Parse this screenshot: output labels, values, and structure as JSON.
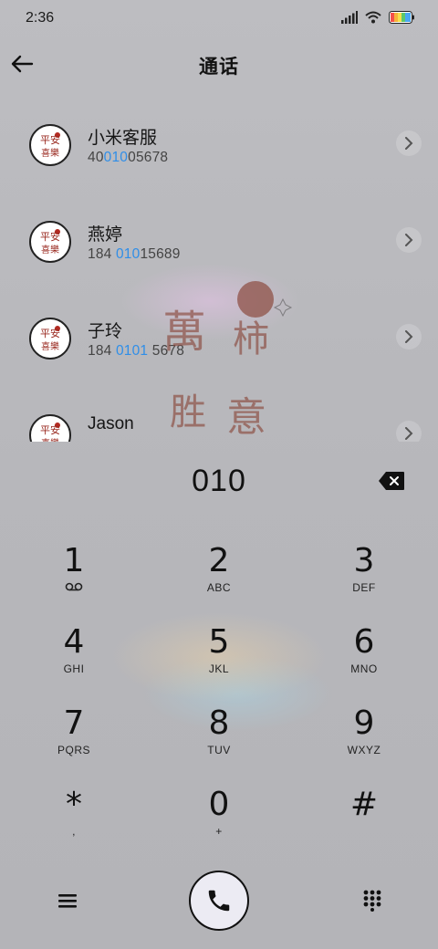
{
  "status_bar": {
    "time": "2:36"
  },
  "header": {
    "title": "通话"
  },
  "contacts": [
    {
      "name": "小米客服",
      "number_pre": "40",
      "number_hl": "010",
      "number_post": "05678"
    },
    {
      "name": "燕婷",
      "number_pre": "184 ",
      "number_hl": "010",
      "number_post": "15689"
    },
    {
      "name": "子玲",
      "number_pre": "184 ",
      "number_hl": "0101",
      "number_post": " 5678"
    },
    {
      "name": "Jason",
      "number_pre": "",
      "number_hl": "",
      "number_post": ""
    }
  ],
  "avatar_text": {
    "line1": "平安",
    "line2": "喜樂"
  },
  "watermark": {
    "chars": [
      "萬",
      "柿",
      "胜",
      "意"
    ]
  },
  "dialer": {
    "entry": "010"
  },
  "keys": [
    {
      "digit": "1",
      "letters": ""
    },
    {
      "digit": "2",
      "letters": "ABC"
    },
    {
      "digit": "3",
      "letters": "DEF"
    },
    {
      "digit": "4",
      "letters": "GHI"
    },
    {
      "digit": "5",
      "letters": "JKL"
    },
    {
      "digit": "6",
      "letters": "MNO"
    },
    {
      "digit": "7",
      "letters": "PQRS"
    },
    {
      "digit": "8",
      "letters": "TUV"
    },
    {
      "digit": "9",
      "letters": "WXYZ"
    },
    {
      "digit": "*",
      "letters": ","
    },
    {
      "digit": "0",
      "letters": "+"
    },
    {
      "digit": "#",
      "letters": ""
    }
  ],
  "icons": {
    "back": "arrow-left-icon",
    "chevron": "chevron-right-icon",
    "delete": "backspace-icon",
    "voicemail": "voicemail-icon",
    "menu": "menu-icon",
    "call": "phone-icon",
    "dialpad": "dialpad-icon"
  },
  "colors": {
    "highlight": "#2f8ee8",
    "watermark": "#8b4a3e"
  }
}
